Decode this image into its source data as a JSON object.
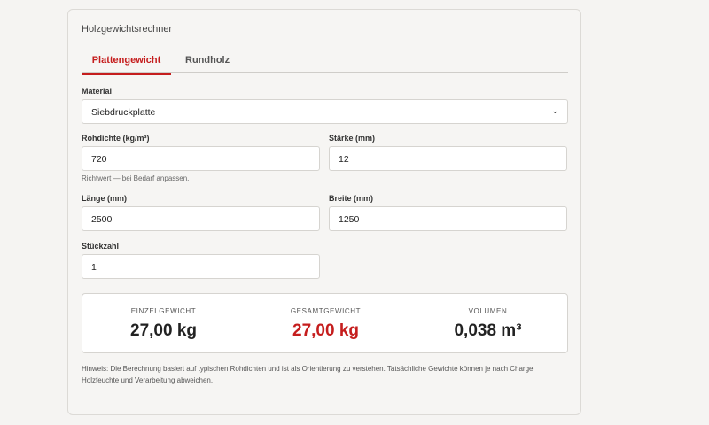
{
  "card": {
    "title": "Holzgewichtsrechner"
  },
  "tabs": [
    {
      "label": "Plattengewicht",
      "active": true
    },
    {
      "label": "Rundholz",
      "active": false
    }
  ],
  "form": {
    "material": {
      "label": "Material",
      "value": "Siebdruckplatte"
    },
    "density": {
      "label": "Rohdichte (kg/m³)",
      "value": "720",
      "hint": "Richtwert — bei Bedarf anpassen."
    },
    "thickness": {
      "label": "Stärke (mm)",
      "value": "12"
    },
    "length": {
      "label": "Länge (mm)",
      "value": "2500"
    },
    "width": {
      "label": "Breite (mm)",
      "value": "1250"
    },
    "quantity": {
      "label": "Stückzahl",
      "value": "1"
    }
  },
  "results": {
    "single_weight": {
      "label": "EINZELGEWICHT",
      "value": "27,00 kg"
    },
    "total_weight": {
      "label": "GESAMTGEWICHT",
      "value": "27,00 kg"
    },
    "volume": {
      "label": "VOLUMEN",
      "value": "0,038 m³"
    }
  },
  "note": "Hinweis: Die Berechnung basiert auf typischen Rohdichten und ist als Orientierung zu verstehen. Tatsächliche Gewichte können je nach Charge, Holzfeuchte und Verarbeitung abweichen.",
  "colors": {
    "accent": "#c51d1d",
    "background": "#f5f4f2",
    "border": "#d6d4d0"
  }
}
